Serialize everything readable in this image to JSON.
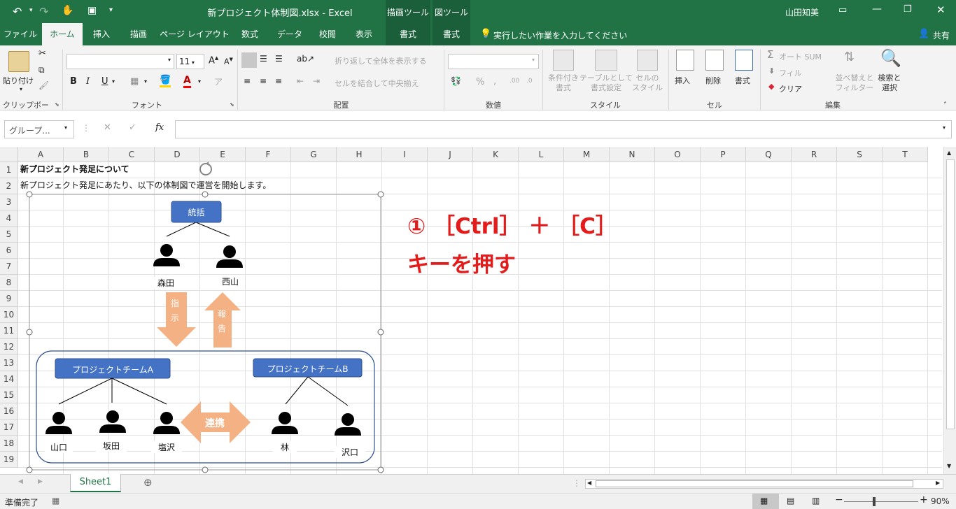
{
  "titlebar": {
    "title": "新プロジェクト体制図.xlsx  -  Excel",
    "ctx_draw": "描画ツール",
    "ctx_diagram": "図ツール",
    "user": "山田知美"
  },
  "tabs": [
    "ファイル",
    "ホーム",
    "挿入",
    "描画",
    "ページ レイアウト",
    "数式",
    "データ",
    "校閲",
    "表示",
    "書式",
    "書式"
  ],
  "tell_me": "実行したい作業を入力してください",
  "share": "共有",
  "ribbon": {
    "paste": "貼り付け",
    "clipboard": "クリップボード",
    "font_size": "11",
    "font": "フォント",
    "bold": "B",
    "italic": "I",
    "underline": "U",
    "wrap": "折り返して全体を表示する",
    "merge": "セルを結合して中央揃え",
    "alignment": "配置",
    "number": "数値",
    "percent": "%",
    "comma": ",",
    "cond_fmt": "条件付き\n書式",
    "table_fmt": "テーブルとして\n書式設定",
    "cell_style": "セルの\nスタイル",
    "styles": "スタイル",
    "insert": "挿入",
    "delete": "削除",
    "format": "書式",
    "cells": "セル",
    "autosum": "オート SUM",
    "fill": "フィル",
    "clear": "クリア",
    "sort": "並べ替えと\nフィルター",
    "find": "検索と\n選択",
    "editing": "編集"
  },
  "formula": {
    "namebox": "グループ...",
    "fx": "fx"
  },
  "columns": [
    "A",
    "B",
    "C",
    "D",
    "E",
    "F",
    "G",
    "H",
    "I",
    "J",
    "K",
    "L",
    "M",
    "N",
    "O",
    "P",
    "Q",
    "R",
    "S",
    "T"
  ],
  "rows": [
    "1",
    "2",
    "3",
    "4",
    "5",
    "6",
    "7",
    "8",
    "9",
    "10",
    "11",
    "12",
    "13",
    "14",
    "15",
    "16",
    "17",
    "18",
    "19"
  ],
  "cells": {
    "a1": "新プロジェクト発足について",
    "a2": "新プロジェクト発足にあたり、以下の体制図で運営を開始します。"
  },
  "diagram": {
    "top": "統括",
    "people_top": [
      "森田",
      "西山"
    ],
    "arrow_down": [
      "指",
      "示"
    ],
    "arrow_up": [
      "報",
      "告"
    ],
    "team_a": "プロジェクトチームA",
    "team_b": "プロジェクトチームB",
    "team_a_members": [
      "山口",
      "坂田",
      "塩沢"
    ],
    "team_b_members": [
      "林",
      "沢口"
    ],
    "link": "連携"
  },
  "annotation": {
    "line1": "① ［Ctrl］ ＋ ［C］",
    "line2": "キーを押す"
  },
  "sheet": {
    "tab": "Sheet1"
  },
  "status": {
    "ready": "準備完了",
    "zoom": "90%"
  },
  "colors": {
    "excel_green": "#217346",
    "shape_blue": "#4472c4",
    "arrow_orange": "#f4b183",
    "annotation_red": "#e31b1b"
  }
}
